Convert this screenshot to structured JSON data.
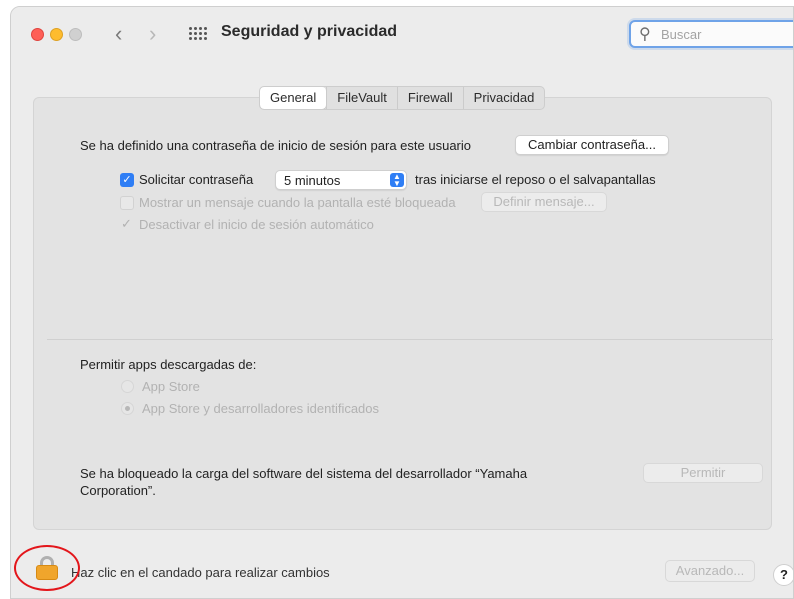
{
  "window": {
    "title": "Seguridad y privacidad",
    "search_placeholder": "Buscar",
    "back_glyph": "‹",
    "forward_glyph": "›"
  },
  "tabs": [
    {
      "label": "General",
      "active": true
    },
    {
      "label": "FileVault",
      "active": false
    },
    {
      "label": "Firewall",
      "active": false
    },
    {
      "label": "Privacidad",
      "active": false
    }
  ],
  "general": {
    "password_text": "Se ha definido una contraseña de inicio de sesión para este usuario",
    "change_password_button": "Cambiar contraseña...",
    "require_password_label": "Solicitar contraseña",
    "require_password_checked": true,
    "require_password_select": "5 minutos",
    "require_password_suffix": "tras iniciarse el reposo o el salvapantallas",
    "show_message_label": "Mostrar un mensaje cuando la pantalla esté bloqueada",
    "set_message_button": "Definir mensaje...",
    "disable_autologin_label": "Desactivar el inicio de sesión automático"
  },
  "allow_apps": {
    "heading": "Permitir apps descargadas de:",
    "options": [
      {
        "label": "App Store",
        "selected": false
      },
      {
        "label": "App Store y desarrolladores identificados",
        "selected": true
      }
    ]
  },
  "blocked": {
    "text_line1": "Se ha bloqueado la carga del software del sistema del desarrollador “Yamaha",
    "text_line2": "Corporation”.",
    "allow_button": "Permitir"
  },
  "footer": {
    "lock_text": "Haz clic en el candado para realizar cambios",
    "advanced_button": "Avanzado...",
    "help_button": "?"
  },
  "colors": {
    "accent": "#2f7ef5",
    "lock": "#f0a52c",
    "annotation_circle": "#e3161b"
  }
}
